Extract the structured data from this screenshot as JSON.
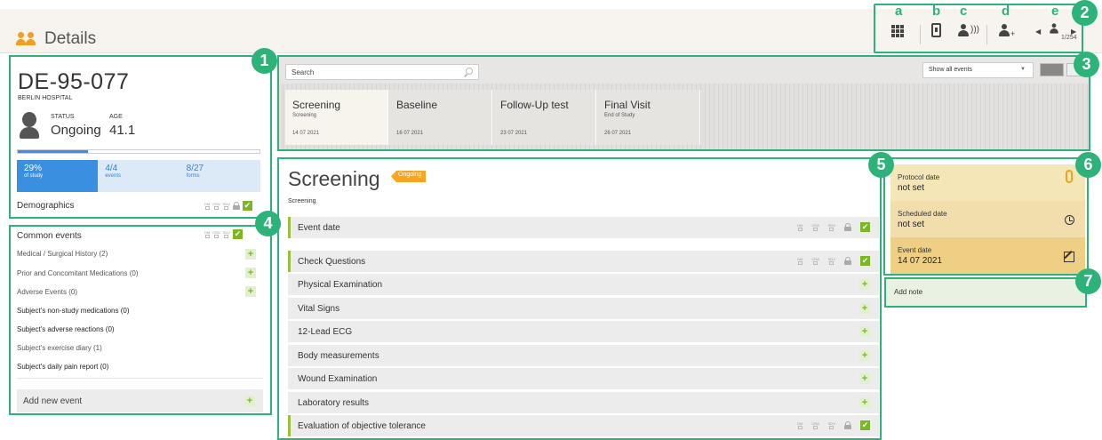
{
  "header": {
    "title": "Details"
  },
  "toolbar": {
    "letters": [
      "a",
      "b",
      "c",
      "d",
      "e"
    ],
    "subject_count": "1/254",
    "icons": [
      "grid-icon",
      "tablet-icon",
      "subject-audio-icon",
      "add-subject-icon",
      "subject-nav-icon"
    ]
  },
  "badges": [
    "1",
    "2",
    "3",
    "4",
    "5",
    "6",
    "7"
  ],
  "subject": {
    "id": "DE-95-077",
    "site": "BERLIN HOSPITAL",
    "status_label": "STATUS",
    "status": "Ongoing",
    "age_label": "AGE",
    "age": "41.1",
    "progress": 0.29,
    "stats": [
      {
        "value": "29%",
        "label": "of study"
      },
      {
        "value": "4/4",
        "label": "events"
      },
      {
        "value": "8/27",
        "label": "forms"
      }
    ],
    "demographics": "Demographics",
    "sig_labels": [
      "DM",
      "CRA",
      "SDV"
    ]
  },
  "common_events": {
    "title": "Common events",
    "items": [
      "Medical / Surgical History (2)",
      "Prior and Concomitant Medications (0)",
      "Adverse Events (0)",
      "Subject's non-study medications (0)",
      "Subject's adverse reactions (0)",
      "Subject's exercise diary (1)",
      "Subject's daily pain report (0)"
    ],
    "add_label": "Add new event"
  },
  "events_strip": {
    "search_placeholder": "Search",
    "filter": "Show all events",
    "events": [
      {
        "name": "Screening",
        "sub": "Screening",
        "date": "14 07 2021"
      },
      {
        "name": "Baseline",
        "sub": "",
        "date": "16 07 2021"
      },
      {
        "name": "Follow-Up test",
        "sub": "",
        "date": "23 07 2021"
      },
      {
        "name": "Final Visit",
        "sub": "End of Study",
        "date": "26 07 2021"
      }
    ]
  },
  "main": {
    "title": "Screening",
    "status": "Ongoing",
    "subtitle": "Screening",
    "forms": [
      "Event date",
      "Check Questions",
      "Physical Examination",
      "Vital Signs",
      "12-Lead ECG",
      "Body measurements",
      "Wound Examination",
      "Laboratory results",
      "Evaluation of objective tolerance"
    ]
  },
  "dates": {
    "protocol_label": "Protocol date",
    "protocol_value": "not set",
    "scheduled_label": "Scheduled date",
    "scheduled_value": "not set",
    "event_label": "Event date",
    "event_value": "14 07 2021"
  },
  "note": {
    "placeholder": "Add note"
  },
  "colors": {
    "accent": "#2db37a",
    "orange": "#f6a623",
    "blue": "#3b8fe0",
    "green_check": "#7cb626"
  }
}
